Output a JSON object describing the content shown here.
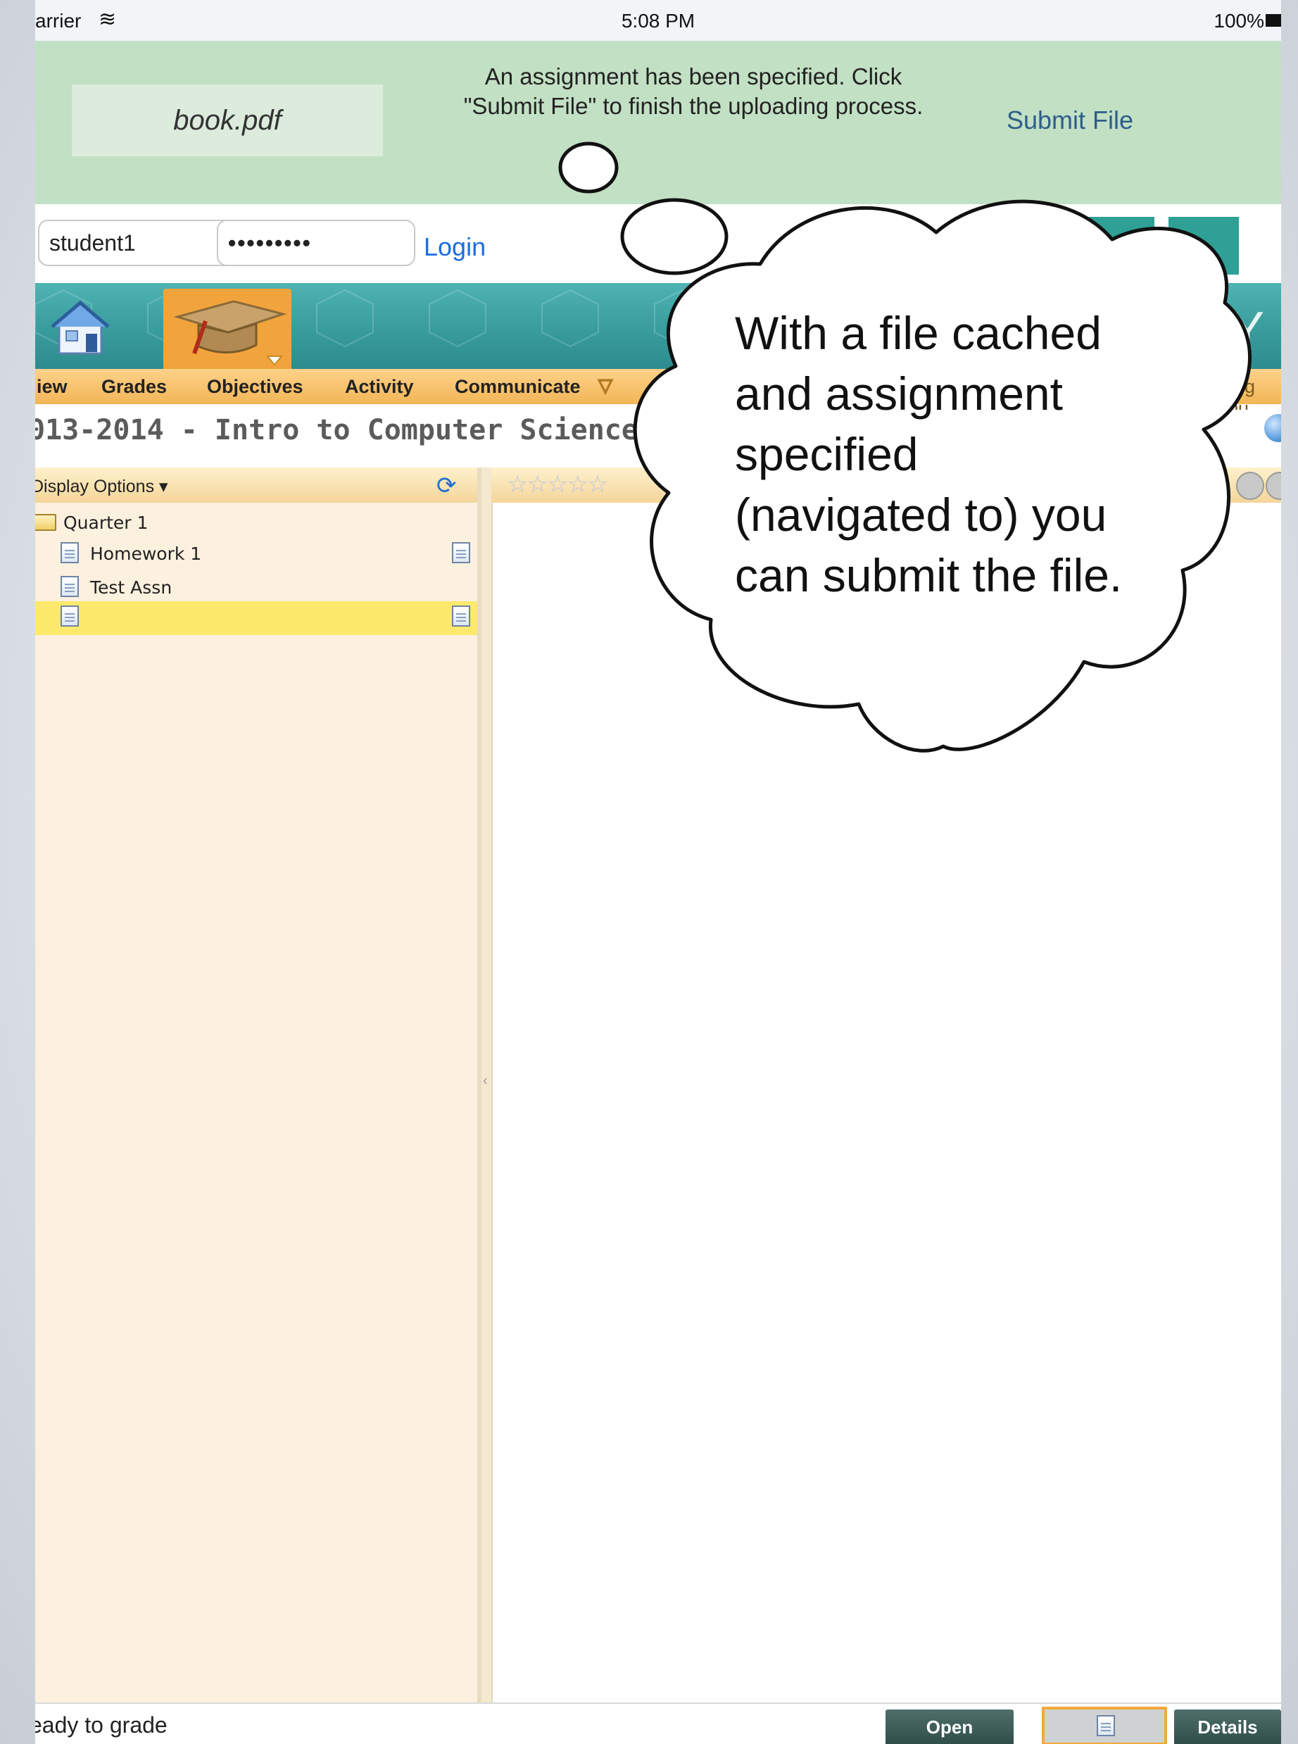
{
  "status_bar": {
    "carrier": "arrier",
    "time": "5:08 PM",
    "battery": "100%"
  },
  "upload_notice": {
    "file_name": "book.pdf",
    "message_line1": "An assignment has been specified. Click",
    "message_line2": "\"Submit File\" to finish the uploading process.",
    "submit_label": "Submit File"
  },
  "login": {
    "username": "student1",
    "password_mask": "•••••••••",
    "login_label": "Login"
  },
  "toolbar_icons": [
    "refresh-icon",
    "home-icon"
  ],
  "banner": {
    "logo_fragment": "eY"
  },
  "nav": {
    "items": [
      {
        "label": "iew"
      },
      {
        "label": "Grades"
      },
      {
        "label": "Objectives"
      },
      {
        "label": "Activity"
      },
      {
        "label": "Communicate"
      }
    ],
    "logout": "Log Ou"
  },
  "course_title": "013-2014 - Intro to Computer Science - I",
  "left_panel": {
    "display_options": "Display Options",
    "tree": [
      {
        "label": "Quarter 1",
        "type": "folder"
      },
      {
        "label": "Homework 1",
        "type": "doc"
      },
      {
        "label": "Test Assn",
        "type": "doc"
      },
      {
        "label": "",
        "type": "doc",
        "selected": true
      }
    ]
  },
  "right_panel": {
    "rating_stars": "☆☆☆☆☆"
  },
  "bottom_bar": {
    "status": "eady to grade",
    "open_label": "Open",
    "details_label": "Details"
  },
  "callout": {
    "text_lines": [
      "With a file cached",
      "and assignment",
      "specified",
      "(navigated to) you",
      "can submit the file."
    ]
  },
  "colors": {
    "notify_bg": "#c2e0c4",
    "accent_teal": "#2fa095",
    "nav_orange": "#f2b556",
    "link_blue": "#1a6ee0"
  }
}
